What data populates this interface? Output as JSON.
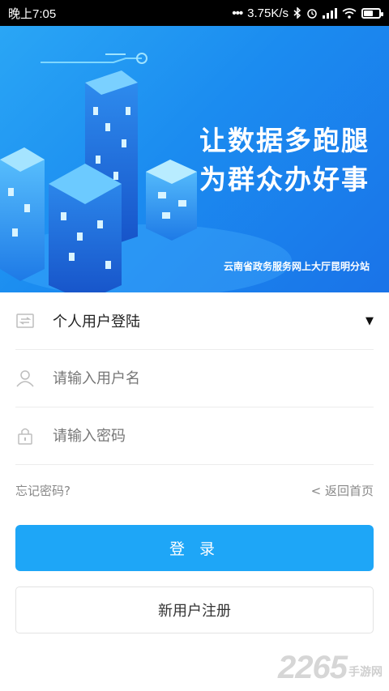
{
  "status_bar": {
    "time": "晚上7:05",
    "network_speed": "3.75K/s",
    "icons": [
      "more-dots-icon",
      "bluetooth-icon",
      "alarm-icon",
      "signal-icon",
      "wifi-icon",
      "battery-icon"
    ],
    "battery_level": 0.6
  },
  "banner": {
    "slogan_line1": "让数据多跑腿",
    "slogan_line2": "为群众办好事",
    "subtitle": "云南省政务服务网上大厅昆明分站"
  },
  "login_form": {
    "user_type": "个人用户登陆",
    "username_placeholder": "请输入用户名",
    "password_placeholder": "请输入密码",
    "forgot_password": "忘记密码?",
    "back_home": "< 返回首页",
    "login_button": "登 录",
    "register_button": "新用户注册"
  },
  "watermark": {
    "number": "2265",
    "text": "手游网"
  },
  "colors": {
    "accent": "#1ea6f7",
    "banner_start": "#2aa6f5",
    "banner_end": "#1a73e8"
  }
}
